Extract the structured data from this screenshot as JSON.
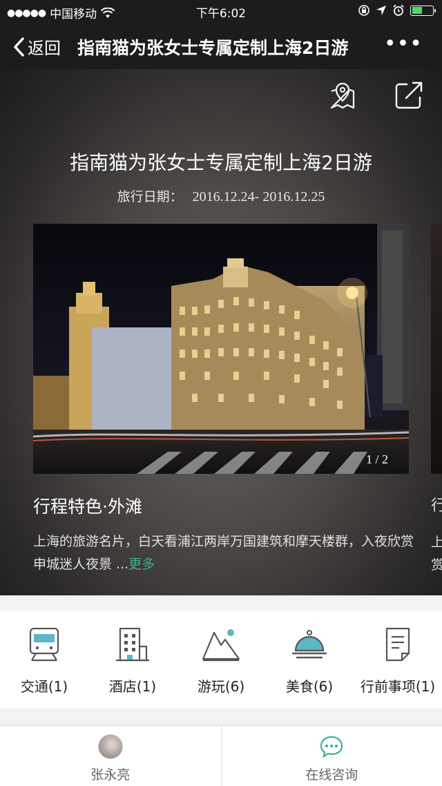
{
  "status_bar": {
    "carrier": "中国移动",
    "time": "下午6:02",
    "battery_color": "#4cd964"
  },
  "nav": {
    "back_label": "返回",
    "title": "指南猫为张女士专属定制上海2日游",
    "more_label": "•••"
  },
  "hero": {
    "title": "指南猫为张女士专属定制上海2日游",
    "date_label": "旅行日期：",
    "date_value": "2016.12.24- 2016.12.25",
    "icons": [
      "map-pin-icon",
      "share-icon"
    ]
  },
  "card": {
    "photo_counter": "1 / 2",
    "title": "行程特色·外滩",
    "description": "上海的旅游名片，白天看浦江两岸万国建筑和摩天楼群，入夜欣赏申城迷人夜景 ...",
    "more_label": "更多",
    "accent_color": "#40b08c"
  },
  "peek_card": {
    "title_fragment": "行",
    "desc_fragment_1": "上",
    "desc_fragment_2": "赏"
  },
  "categories": [
    {
      "label": "交通(1)",
      "icon": "train-icon"
    },
    {
      "label": "酒店(1)",
      "icon": "hotel-icon"
    },
    {
      "label": "游玩(6)",
      "icon": "mountain-icon"
    },
    {
      "label": "美食(6)",
      "icon": "food-cloche-icon"
    },
    {
      "label": "行前事项(1)",
      "icon": "document-icon"
    }
  ],
  "bottom_bar": {
    "agent_name": "张永亮",
    "consult_label": "在线咨询",
    "consult_color": "#40b08c"
  }
}
